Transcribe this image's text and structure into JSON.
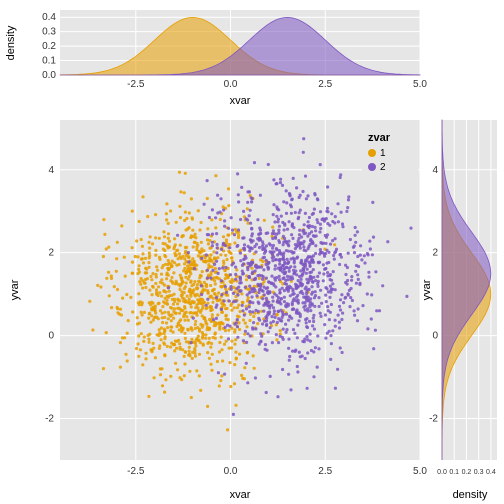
{
  "chart_data": [
    {
      "type": "density",
      "role": "top-marginal",
      "xlabel": "xvar",
      "ylabel": "density",
      "xlim": [
        -4.5,
        5.0
      ],
      "ylim": [
        0,
        0.45
      ],
      "xticks": [
        -2.5,
        0.0,
        2.5,
        5.0
      ],
      "yticks": [
        0.0,
        0.1,
        0.2,
        0.3,
        0.4
      ],
      "series": [
        {
          "name": "1",
          "color": "#E69F00",
          "fill": "#E69F00",
          "alpha": 0.55,
          "mean": -1.0,
          "sd": 1.0
        },
        {
          "name": "2",
          "color": "#7E57C2",
          "fill": "#7E57C2",
          "alpha": 0.55,
          "mean": 1.5,
          "sd": 1.0
        }
      ]
    },
    {
      "type": "scatter",
      "role": "main",
      "xlabel": "xvar",
      "ylabel": "yvar",
      "xlim": [
        -4.5,
        5.0
      ],
      "ylim": [
        -3.0,
        5.2
      ],
      "xticks": [
        -2.5,
        0.0,
        2.5,
        5.0
      ],
      "yticks": [
        -2,
        0,
        2,
        4
      ],
      "legend": {
        "title": "zvar",
        "items": [
          {
            "label": "1",
            "color": "#E69F00"
          },
          {
            "label": "2",
            "color": "#7E57C2"
          }
        ]
      },
      "series": [
        {
          "name": "1",
          "color": "#E69F00",
          "n": 1000,
          "mean_x": -1.0,
          "sd_x": 1.0,
          "mean_y": 1.0,
          "sd_y": 1.0
        },
        {
          "name": "2",
          "color": "#7E57C2",
          "n": 1000,
          "mean_x": 1.5,
          "sd_x": 1.0,
          "mean_y": 1.5,
          "sd_y": 1.0
        }
      ]
    },
    {
      "type": "density",
      "role": "right-marginal",
      "orientation": "vertical",
      "xlabel": "density",
      "ylabel": "yvar",
      "xlim": [
        0,
        0.45
      ],
      "ylim": [
        -3.0,
        5.2
      ],
      "xticks": [
        0.0,
        0.1,
        0.2,
        0.3,
        0.4
      ],
      "yticks": [
        -2,
        0,
        2,
        4
      ],
      "series": [
        {
          "name": "1",
          "color": "#E69F00",
          "fill": "#E69F00",
          "alpha": 0.55,
          "mean": 1.0,
          "sd": 1.0
        },
        {
          "name": "2",
          "color": "#7E57C2",
          "fill": "#7E57C2",
          "alpha": 0.55,
          "mean": 1.5,
          "sd": 1.0
        }
      ]
    }
  ],
  "labels": {
    "top_x": "xvar",
    "top_y": "density",
    "main_x": "xvar",
    "main_y": "yvar",
    "right_x": "density",
    "right_y": "yvar",
    "legend_title": "zvar",
    "legend_1": "1",
    "legend_2": "2"
  },
  "colors": {
    "group1": "#E69F00",
    "group2": "#7E57C2"
  }
}
